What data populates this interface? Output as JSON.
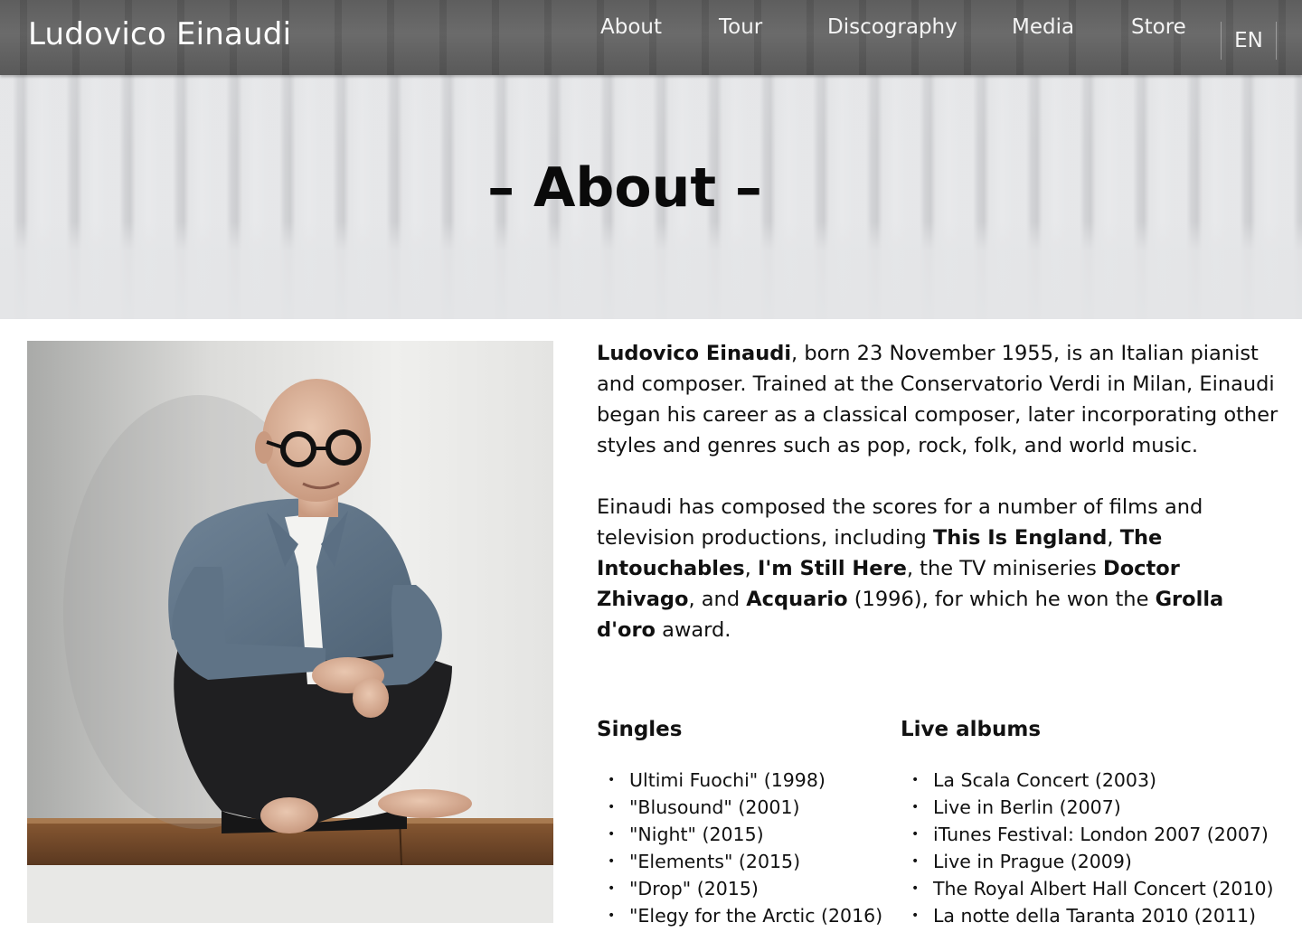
{
  "header": {
    "brand": "Ludovico Einaudi",
    "nav": {
      "about": "About",
      "tour": "Tour",
      "discography": "Discography",
      "media": "Media",
      "store": "Store"
    },
    "language": "EN"
  },
  "hero": {
    "title": "– About –"
  },
  "bio": {
    "p1": {
      "name": "Ludovico Einaudi",
      "text": ", born 23 November 1955, is an Italian pianist and composer. Trained at the Conservatorio Verdi in Milan, Einaudi began his career as a classical composer, later incorporating other styles and genres such as pop, rock, folk, and world music."
    },
    "p2": {
      "t1": "Einaudi has composed the scores for a number of films and television productions, including ",
      "b1": "This Is England",
      "t2": ", ",
      "b2": "The Intouchables",
      "t3": ", ",
      "b3": "I'm Still Here",
      "t4": ", the TV miniseries ",
      "b4": "Doctor Zhivago",
      "t5": ", and ",
      "b5": "Acquario",
      "t6": " (1996), for which he won the ",
      "b6": "Grolla d'oro",
      "t7": " award."
    }
  },
  "singles": {
    "title": "Singles",
    "items": [
      "Ultimi Fuochi\" (1998)",
      "\"Blusound\" (2001)",
      "\"Night\" (2015)",
      "\"Elements\" (2015)",
      "\"Drop\" (2015)",
      "\"Elegy for the Arctic (2016)"
    ]
  },
  "live_albums": {
    "title": "Live albums",
    "items": [
      "La Scala Concert  (2003)",
      "Live in Berlin (2007)",
      "iTunes Festival: London 2007 (2007)",
      "Live in Prague (2009)",
      "The Royal Albert Hall Concert (2010)",
      "La notte della Taranta 2010 (2011)"
    ]
  }
}
